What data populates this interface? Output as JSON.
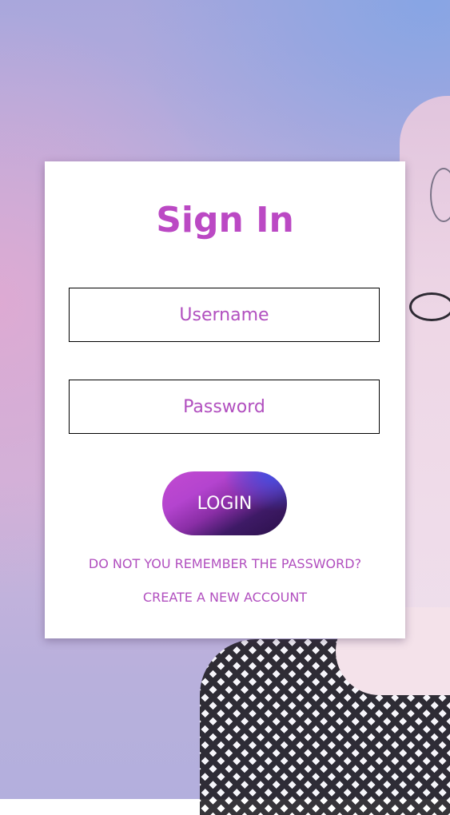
{
  "signin": {
    "title": "Sign In",
    "username_placeholder": "Username",
    "password_placeholder": "Password",
    "login_label": "LOGIN",
    "forgot_password_label": "DO NOT YOU REMEMBER THE PASSWORD?",
    "create_account_label": "CREATE A NEW ACCOUNT"
  },
  "colors": {
    "accent": "#bb49c4",
    "button_gradient_start": "#c24ad0",
    "button_gradient_end": "#2a1049",
    "button_highlight": "#3c50e6"
  }
}
